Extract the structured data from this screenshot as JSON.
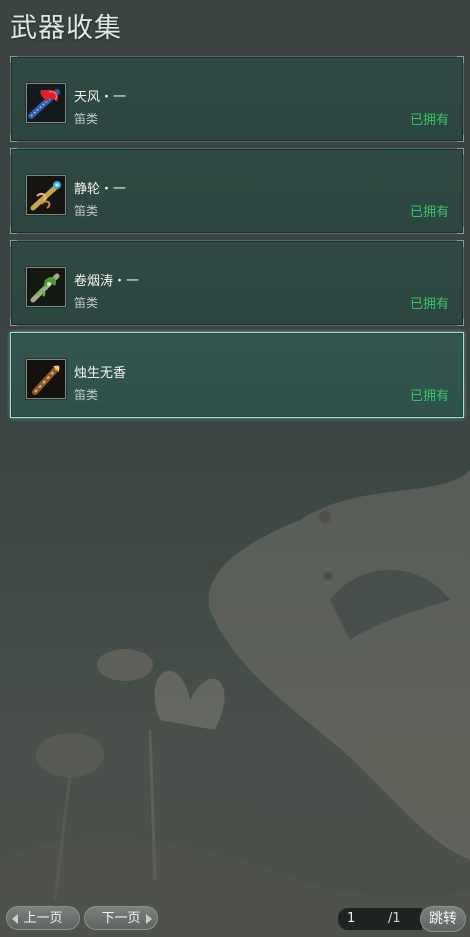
{
  "page_title": "武器收集",
  "items": [
    {
      "name": "天风・一",
      "category": "笛类",
      "status": "已拥有",
      "icon": "red-flute-icon",
      "selected": false
    },
    {
      "name": "静轮・一",
      "category": "笛类",
      "status": "已拥有",
      "icon": "gold-flute-icon",
      "selected": false
    },
    {
      "name": "卷烟涛・一",
      "category": "笛类",
      "status": "已拥有",
      "icon": "green-flute-icon",
      "selected": false
    },
    {
      "name": "烛生无香",
      "category": "笛类",
      "status": "已拥有",
      "icon": "bronze-flute-icon",
      "selected": true
    }
  ],
  "pagination": {
    "prev_label": "上一页",
    "next_label": "下一页",
    "current_page": "1",
    "total_pages": "/1",
    "jump_label": "跳转"
  },
  "colors": {
    "owned": "#35c46a",
    "selected_border": "#9fe5da",
    "panel": "#2f4a44"
  }
}
